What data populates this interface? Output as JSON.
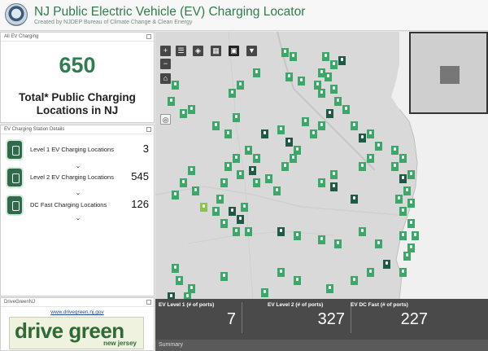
{
  "header": {
    "title": "NJ Public Electric Vehicle (EV) Charging Locator",
    "subtitle": "Created by NJDEP Bureau of Climate Change & Clean Energy"
  },
  "panel_total": {
    "heading": "All EV Charging",
    "value": "650",
    "label": "Total* Public Charging Locations in NJ"
  },
  "panel_details": {
    "heading": "EV Charging Station Details",
    "rows": [
      {
        "label": "Level 1 EV Charging Locations",
        "value": "3",
        "icon": "ev-charger-icon"
      },
      {
        "label": "Level 2 EV Charging Locations",
        "value": "545",
        "icon": "ev-charger-icon"
      },
      {
        "label": "DC Fast Charging Locations",
        "value": "126",
        "icon": "ev-charger-icon"
      }
    ]
  },
  "panel_drivegreen": {
    "heading": "DriveGreenNJ",
    "link": "www.drivegreen.nj.gov",
    "logo_text": "drive green",
    "logo_sub": "new jersey"
  },
  "map_tools": {
    "zoom_in": "+",
    "zoom_out": "−",
    "home": "⌂",
    "legend": "☰",
    "layers": "◈",
    "basemap": "▦",
    "qr": "▣",
    "filter": "▼",
    "locate": "◎"
  },
  "summary": {
    "columns": [
      {
        "label": "EV Level 1 (# of ports)",
        "value": "7"
      },
      {
        "label": "EV Level 2 (# of ports)",
        "value": "327"
      },
      {
        "label": "EV DC Fast (# of ports)",
        "value": "227"
      }
    ],
    "bar_label": "Summary"
  },
  "colors": {
    "accent_green": "#2e7d4f",
    "pin_light": "#3aa867",
    "pin_dark": "#1f5a44",
    "pin_selected": "#8bc34a"
  }
}
